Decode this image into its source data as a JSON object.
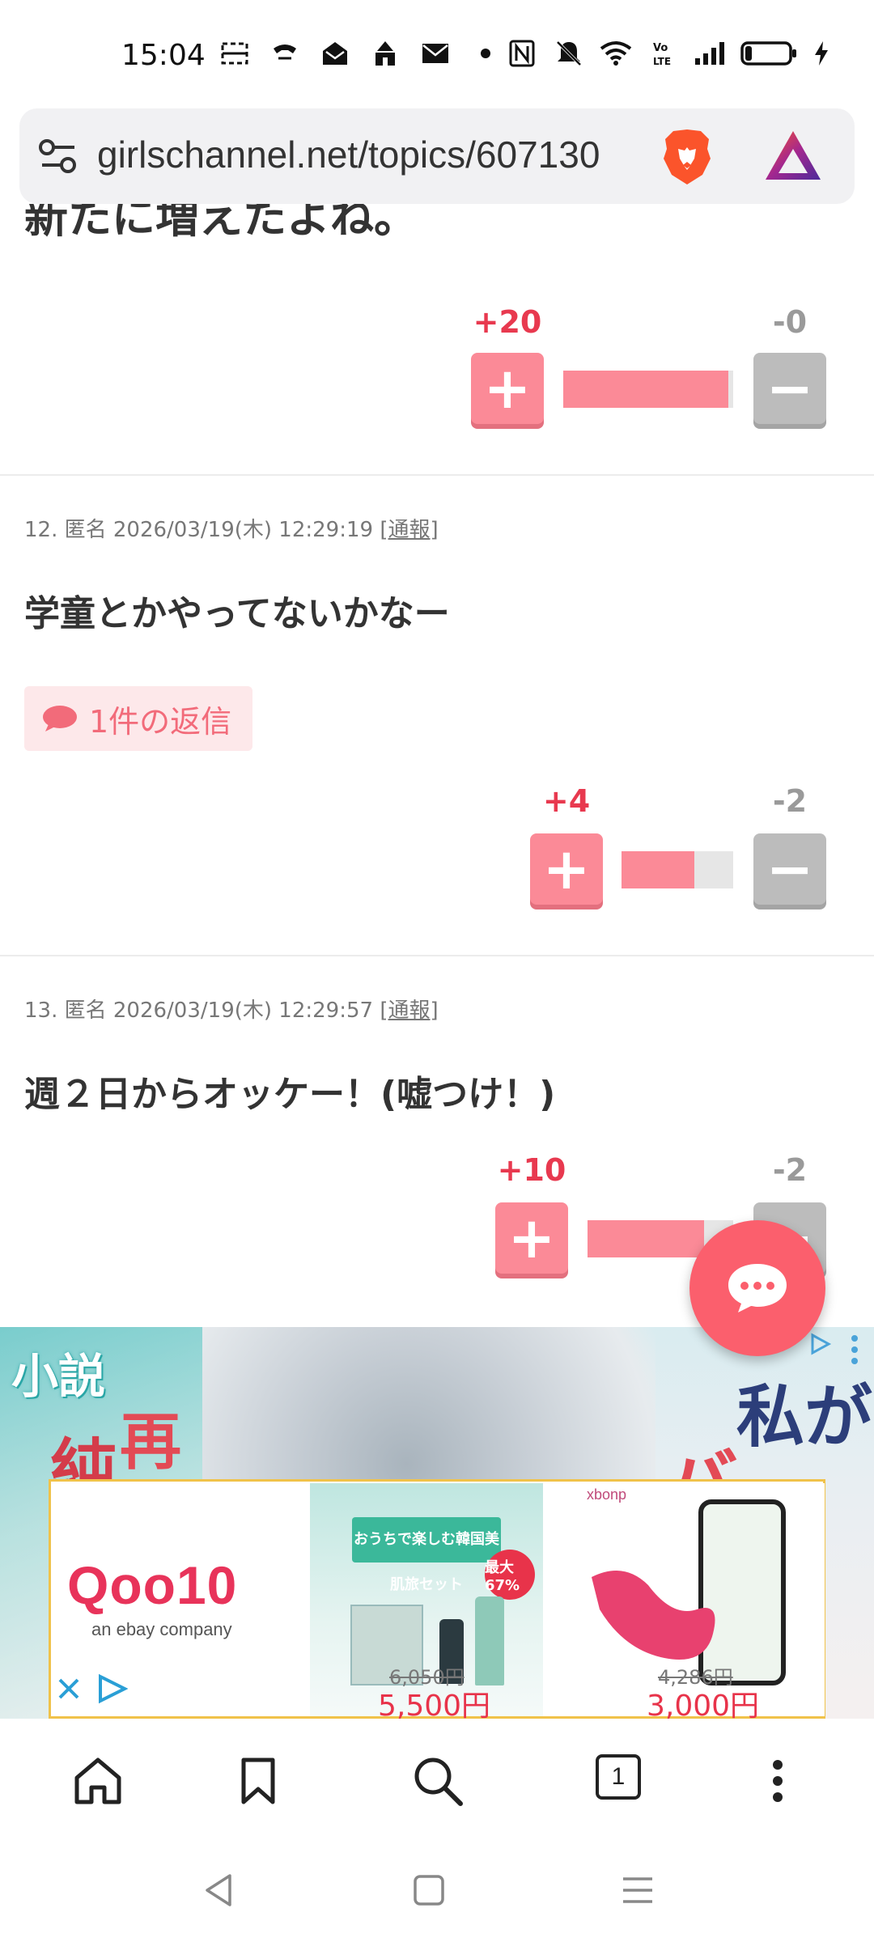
{
  "status_bar": {
    "time": "15:04",
    "icons": [
      "screenshot-icon",
      "call-icon",
      "mail-open-icon",
      "castle-icon",
      "mail-icon",
      "dot-icon",
      "nfc-icon",
      "mute-icon",
      "wifi-icon",
      "volte-icon",
      "signal-icon",
      "battery-icon",
      "charging-icon"
    ]
  },
  "browser": {
    "url": "girlschannel.net/topics/607130",
    "tab_count": "1"
  },
  "clipped_comment": {
    "text": "新たに増えたよね。",
    "plus_count": "+20",
    "minus_count": "-0",
    "plus_ratio": 0.97
  },
  "comments": [
    {
      "meta_prefix": "12. 匿名 2026/03/19(木) 12:29:19 ",
      "report": "[通報]",
      "body": "学童とかやってないかなー",
      "reply_label": "1件の返信",
      "plus_count": "+4",
      "minus_count": "-2",
      "plus_ratio": 0.65
    },
    {
      "meta_prefix": "13. 匿名 2026/03/19(木) 12:29:57 ",
      "report": "[通報]",
      "body": "週２日からオッケー！(嘘つけ！)",
      "plus_count": "+10",
      "minus_count": "-2",
      "plus_ratio": 0.8
    }
  ],
  "ad": {
    "bg_text_left_1": "小説",
    "bg_text_left_2": "再",
    "bg_text_left_3": "純",
    "bg_text_right_1": "私が",
    "bg_text_right_2": "バ",
    "banner_brand": "Qoo10",
    "banner_brand_sub": "an ebay company",
    "product1": {
      "tag": "おうちで楽しむ韓国美肌旅セット",
      "badge": "最大67%",
      "old_price": "6,050円",
      "new_price": "5,500円"
    },
    "product2": {
      "brand": "xbonp",
      "old_price": "4,286円",
      "new_price": "3,000円"
    }
  },
  "colors": {
    "accent": "#fb8a97",
    "plus_text": "#e8394f",
    "minus_text": "#9a9a9a",
    "fab": "#fb5f6d"
  }
}
